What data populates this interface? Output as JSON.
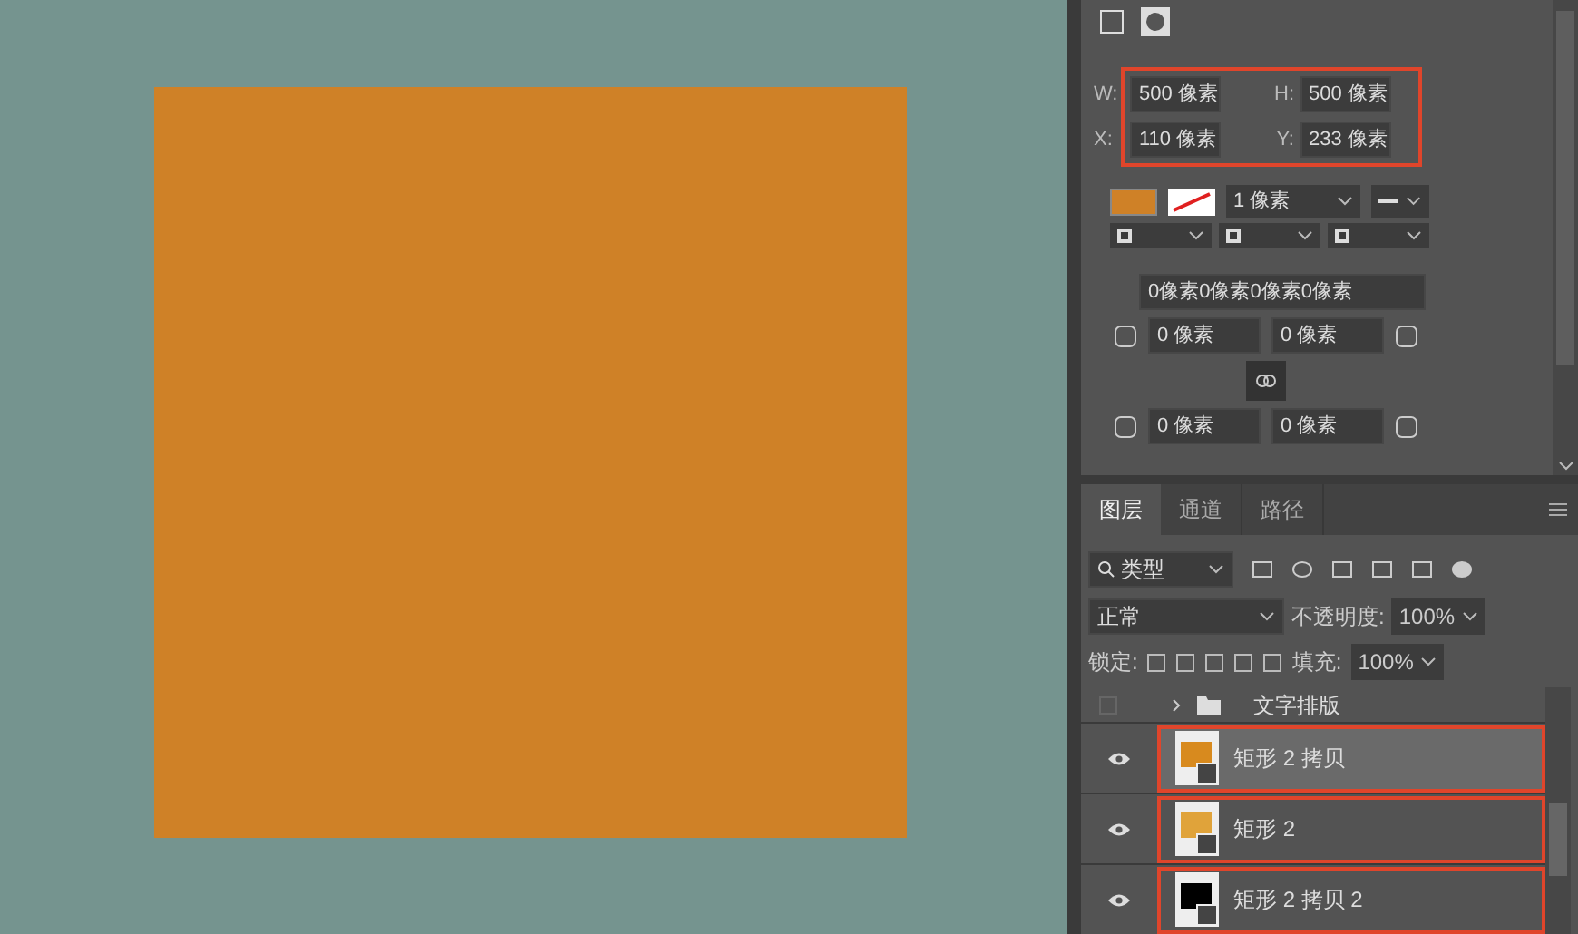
{
  "properties": {
    "size_highlighted": true,
    "fields": [
      {
        "label": "W:",
        "value": "500 像素"
      },
      {
        "label": "H:",
        "value": "500 像素"
      },
      {
        "label": "X:",
        "value": "110 像素"
      },
      {
        "label": "Y:",
        "value": "233 像素"
      }
    ],
    "stroke_width": "1 像素",
    "corners_all": "0像素0像素0像素0像素",
    "corners": [
      "0 像素",
      "0 像素",
      "0 像素",
      "0 像素"
    ]
  },
  "layers_panel": {
    "tabs": [
      {
        "label": "图层",
        "selected": true
      },
      {
        "label": "通道",
        "selected": false
      },
      {
        "label": "路径",
        "selected": false
      }
    ],
    "filter": "类型",
    "blend_mode": "正常",
    "opacity_label": "不透明度:",
    "opacity": "100%",
    "lock_label": "锁定:",
    "fill_label": "填充:",
    "fill": "100%",
    "layers": [
      {
        "kind": "group",
        "name": "文字排版",
        "visible": false,
        "selected": false,
        "highlighted": false
      },
      {
        "kind": "shape",
        "name": "矩形 2 拷贝",
        "visible": true,
        "selected": true,
        "highlighted": true,
        "color": "#d88a1e"
      },
      {
        "kind": "shape",
        "name": "矩形 2",
        "visible": true,
        "selected": false,
        "highlighted": true,
        "color": "#e0a33a"
      },
      {
        "kind": "shape",
        "name": "矩形 2 拷贝 2",
        "visible": true,
        "selected": false,
        "highlighted": true,
        "color": "#000000"
      }
    ]
  }
}
